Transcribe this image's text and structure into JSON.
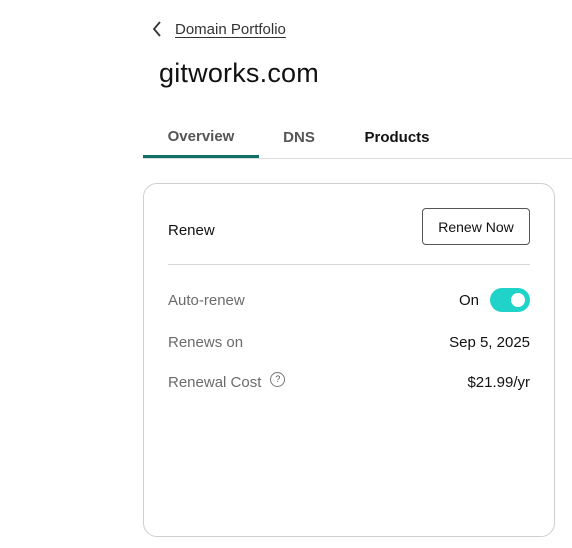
{
  "nav": {
    "back_label": "Domain Portfolio"
  },
  "domain": {
    "name": "gitworks.com"
  },
  "tabs": [
    {
      "label": "Overview",
      "active": true
    },
    {
      "label": "DNS",
      "active": false
    },
    {
      "label": "Products",
      "active": false
    }
  ],
  "renew_card": {
    "title": "Renew",
    "button_label": "Renew Now",
    "auto_renew": {
      "label": "Auto-renew",
      "status": "On",
      "enabled": true
    },
    "renews_on": {
      "label": "Renews on",
      "value": "Sep 5, 2025"
    },
    "renewal_cost": {
      "label": "Renewal Cost",
      "value": "$21.99/yr",
      "help_glyph": "?"
    }
  },
  "colors": {
    "tab_active_underline": "#0f6e66",
    "toggle_on": "#1fd3c8"
  },
  "icons": {
    "back": "chevron-left-icon",
    "help": "help-circle-icon"
  }
}
